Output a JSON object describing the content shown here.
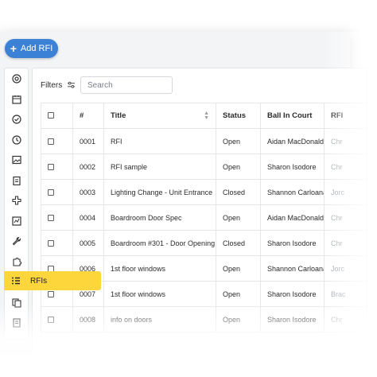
{
  "toolbar": {
    "add_label": "Add RFI",
    "add_icon": "plus-icon"
  },
  "colors": {
    "primary": "#3b82d6",
    "active": "#fcd63a"
  },
  "sidebar": {
    "icons": [
      "target-icon",
      "calendar-icon",
      "check-circle-icon",
      "clock-icon",
      "image-icon",
      "clipboard-icon",
      "plus-cross-icon",
      "chart-icon",
      "wrench-icon",
      "puzzle-icon"
    ],
    "active_label": "RFIs",
    "lower_icons": [
      "document-swap-icon",
      "document-icon"
    ]
  },
  "filters": {
    "label": "Filters",
    "search_placeholder": "Search"
  },
  "table": {
    "headers": [
      "#",
      "Title",
      "Status",
      "Ball In Court",
      "RFI"
    ],
    "rows": [
      {
        "num": "0001",
        "title": "RFI",
        "status": "Open",
        "ball": "Aidan MacDonald",
        "rfi": "Chr"
      },
      {
        "num": "0002",
        "title": "RFI sample",
        "status": "Open",
        "ball": "Sharon Isodore",
        "rfi": "Chr"
      },
      {
        "num": "0003",
        "title": "Lighting Change - Unit Entrance",
        "status": "Closed",
        "ball": "Shannon Carloana",
        "rfi": "Jorc"
      },
      {
        "num": "0004",
        "title": "Boardroom Door Spec",
        "status": "Open",
        "ball": "Aidan MacDonald",
        "rfi": "Chr"
      },
      {
        "num": "0005",
        "title": "Boardroom #301 - Door Opening",
        "status": "Closed",
        "ball": "Sharon Isodore",
        "rfi": "Chr"
      },
      {
        "num": "0006",
        "title": "1st floor windows",
        "status": "Open",
        "ball": "Shannon Carloana",
        "rfi": "Jorc"
      },
      {
        "num": "0007",
        "title": "1st floor windows",
        "status": "Open",
        "ball": "Sharon Isodore",
        "rfi": "Brac"
      },
      {
        "num": "0008",
        "title": "info on doors",
        "status": "Open",
        "ball": "Sharon Isodore",
        "rfi": "Chr"
      }
    ]
  }
}
